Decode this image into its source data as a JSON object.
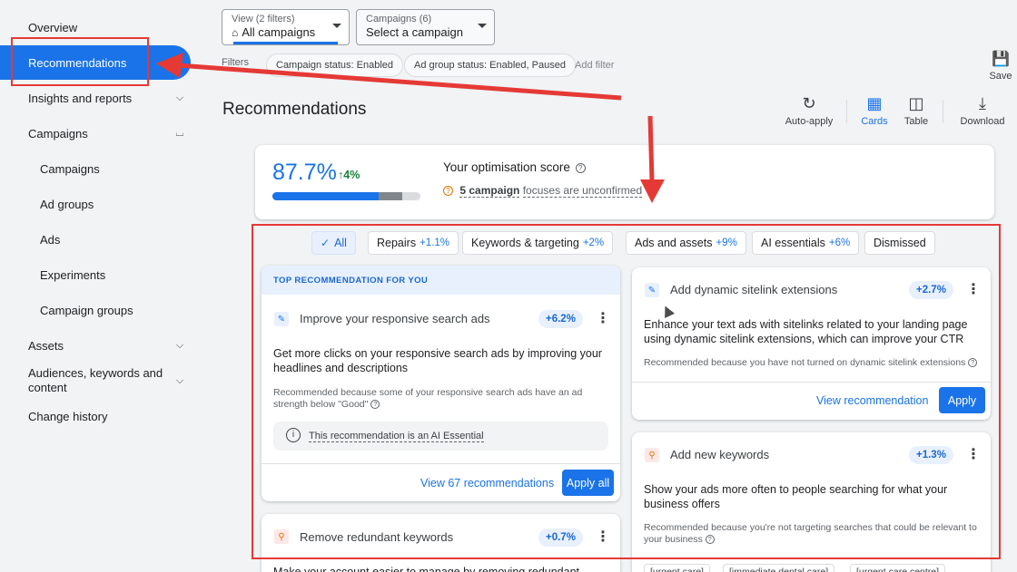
{
  "sidebar": {
    "items": [
      {
        "label": "Overview"
      },
      {
        "label": "Recommendations"
      },
      {
        "label": "Insights and reports"
      },
      {
        "label": "Campaigns"
      },
      {
        "label": "Campaigns"
      },
      {
        "label": "Ad groups"
      },
      {
        "label": "Ads"
      },
      {
        "label": "Experiments"
      },
      {
        "label": "Campaign groups"
      },
      {
        "label": "Assets"
      },
      {
        "label": "Audiences, keywords and content"
      },
      {
        "label": "Change history"
      }
    ]
  },
  "header": {
    "view_caption": "View (2 filters)",
    "view_value": "All campaigns",
    "campaign_caption": "Campaigns (6)",
    "campaign_value": "Select a campaign",
    "filters_label": "Filters",
    "filter_chips": [
      "Campaign status: Enabled",
      "Ad group status: Enabled, Paused"
    ],
    "add_filter": "Add filter",
    "save_label": "Save"
  },
  "page": {
    "title": "Recommendations",
    "tools": [
      "Auto-apply",
      "Cards",
      "Table",
      "Download"
    ]
  },
  "score": {
    "value": "87.7%",
    "change": "4%",
    "progress_fraction": 0.877,
    "title": "Your optimisation score",
    "note_link": "5 campaign",
    "note_rest": "focuses are unconfirmed"
  },
  "tabs": [
    {
      "label": "All",
      "pct": ""
    },
    {
      "label": "Repairs",
      "pct": "+1.1%"
    },
    {
      "label": "Keywords & targeting",
      "pct": "+2%"
    },
    {
      "label": "Ads and assets",
      "pct": "+9%"
    },
    {
      "label": "AI essentials",
      "pct": "+6%"
    },
    {
      "label": "Dismissed",
      "pct": ""
    }
  ],
  "cards": {
    "top_label": "TOP RECOMMENDATION FOR YOU",
    "rsa": {
      "title": "Improve your responsive search ads",
      "badge": "+6.2%",
      "body": "Get more clicks on your responsive search ads by improving your headlines and descriptions",
      "why": "Recommended because some of your responsive search ads have an ad strength below \"Good\"",
      "ai_note": "This recommendation is an AI Essential",
      "view_link": "View 67 recommendations",
      "apply": "Apply all"
    },
    "redundant": {
      "title": "Remove redundant keywords",
      "badge": "+0.7%",
      "body": "Make your account easier to manage by removing redundant"
    },
    "sitelink": {
      "title": "Add dynamic sitelink extensions",
      "badge": "+2.7%",
      "body": "Enhance your text ads with sitelinks related to your landing page using dynamic sitelink extensions, which can improve your CTR",
      "why": "Recommended because you have not turned on dynamic sitelink extensions",
      "view_link": "View recommendation",
      "apply": "Apply"
    },
    "keywords": {
      "title": "Add new keywords",
      "badge": "+1.3%",
      "body": "Show your ads more often to people searching for what your business offers",
      "why": "Recommended because you're not targeting searches that could be relevant to your business",
      "chips": [
        "[urgent care]",
        "[immediate dental care]",
        "[urgent care centre]"
      ]
    }
  },
  "colors": {
    "accent": "#1a73e8",
    "annotation": "#e53935",
    "positive": "#188038"
  }
}
